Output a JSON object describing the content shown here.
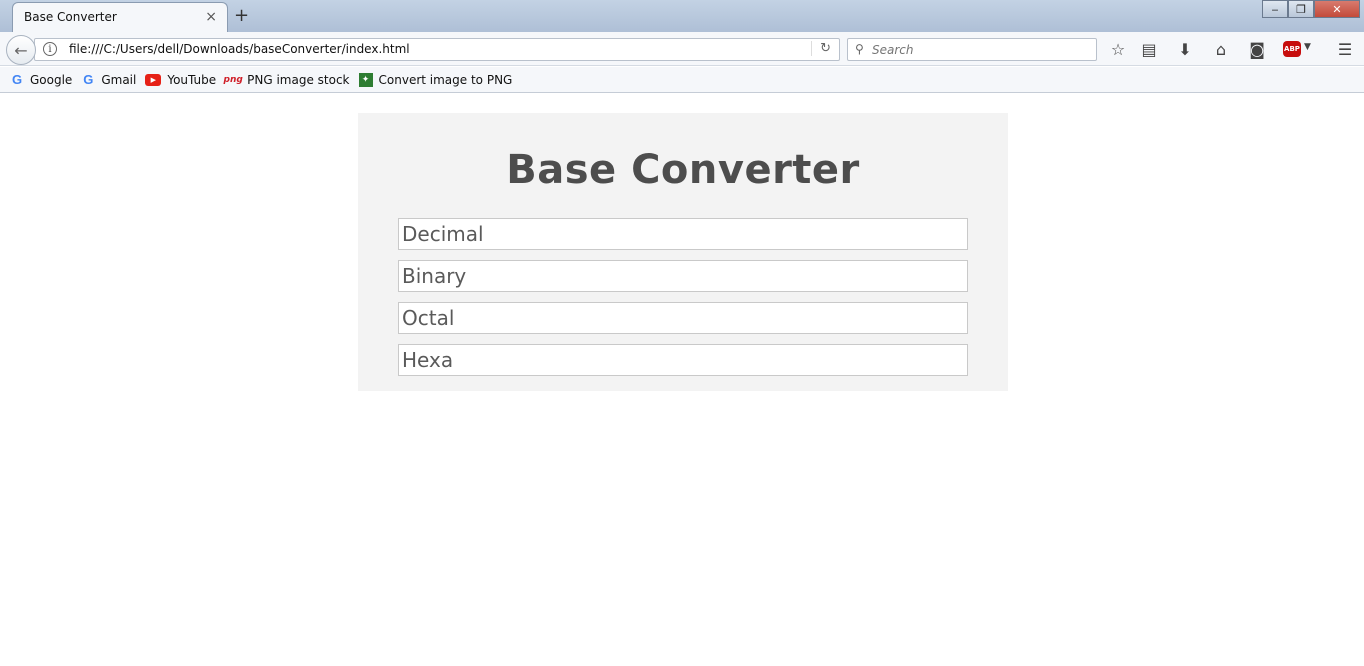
{
  "browser": {
    "tab_title": "Base Converter",
    "tab_close": "×",
    "new_tab": "+",
    "url": "file:///C:/Users/dell/Downloads/baseConverter/index.html",
    "search_placeholder": "Search",
    "abp_label": "ABP",
    "window_controls": {
      "minimize": "‒",
      "restore": "❐",
      "close": "✕"
    }
  },
  "bookmarks": [
    {
      "label": "Google",
      "icon": "google-icon"
    },
    {
      "label": "Gmail",
      "icon": "google-icon"
    },
    {
      "label": "YouTube",
      "icon": "youtube-icon"
    },
    {
      "label": "PNG image stock",
      "icon": "png-icon"
    },
    {
      "label": "Convert image to PNG",
      "icon": "convert-icon"
    }
  ],
  "page": {
    "title": "Base Converter",
    "fields": {
      "decimal": "Decimal",
      "binary": "Binary",
      "octal": "Octal",
      "hexa": "Hexa"
    }
  }
}
